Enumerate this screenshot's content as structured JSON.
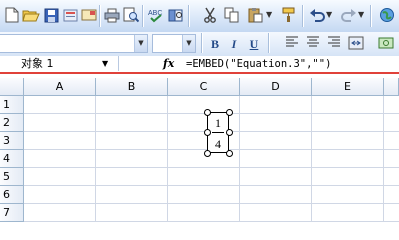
{
  "toolbar": {
    "buttons": [
      {
        "name": "new-icon",
        "glyph": "▫"
      },
      {
        "name": "open-icon",
        "glyph": "📂"
      },
      {
        "name": "save-icon",
        "glyph": "💾"
      },
      {
        "name": "permission-icon",
        "glyph": "🔒"
      },
      {
        "name": "email-icon",
        "glyph": "✉"
      },
      {
        "name": "print-icon",
        "glyph": "🖨"
      },
      {
        "name": "print-preview-icon",
        "glyph": "🔍"
      },
      {
        "name": "spelling-icon",
        "glyph": "✓"
      },
      {
        "name": "research-icon",
        "glyph": "📖"
      },
      {
        "name": "cut-icon",
        "glyph": "✂"
      },
      {
        "name": "copy-icon",
        "glyph": "⧉"
      },
      {
        "name": "paste-icon",
        "glyph": "📋"
      },
      {
        "name": "format-painter-icon",
        "glyph": "🖌"
      },
      {
        "name": "undo-icon",
        "glyph": "↶"
      },
      {
        "name": "redo-icon",
        "glyph": "↷"
      },
      {
        "name": "hyperlink-icon",
        "glyph": "🌐"
      }
    ]
  },
  "format_toolbar": {
    "bold": "B",
    "italic": "I",
    "underline": "U",
    "align_left_glyph": "≡",
    "center_glyph": "≡",
    "align_right_glyph": "≡",
    "merge_glyph": "⊞"
  },
  "formula_bar": {
    "name_box": "对象 1",
    "fx": "fx",
    "formula": "=EMBED(\"Equation.3\",\"\")"
  },
  "grid": {
    "columns": [
      "A",
      "B",
      "C",
      "D",
      "E"
    ],
    "rows": [
      "1",
      "2",
      "3",
      "4",
      "5",
      "6",
      "7"
    ]
  },
  "equation_object": {
    "numerator": "1",
    "denominator": "4"
  },
  "colors": {
    "toolbar_top": "#f7fbff",
    "toolbar_bottom": "#c4d8f2",
    "gridline": "#d0d7e5",
    "header_border": "#9eb6ce",
    "formula_underline": "#e0413a"
  }
}
